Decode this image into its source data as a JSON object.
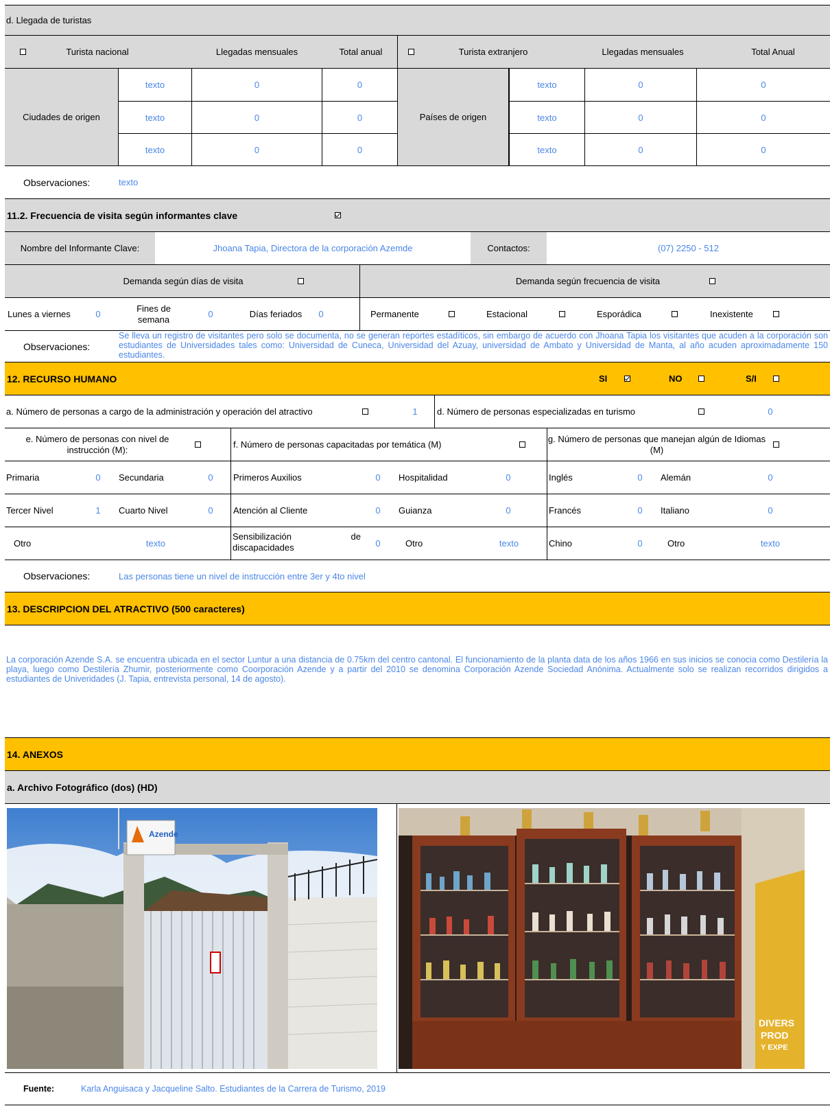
{
  "arrivals": {
    "title": "d. Llegada de turistas",
    "national_label": "Turista nacional",
    "monthly_label": "Llegadas mensuales",
    "annual_label": "Total anual",
    "foreign_label": "Turista extranjero",
    "foreign_monthly_label": "Llegadas mensuales",
    "foreign_annual_label": "Total Anual",
    "cities_label": "Ciudades de origen",
    "countries_label": "Países de origen",
    "rows": [
      {
        "city": "texto",
        "city_monthly": "0",
        "city_annual": "0",
        "country": "texto",
        "country_monthly": "0",
        "country_annual": "0"
      },
      {
        "city": "texto",
        "city_monthly": "0",
        "city_annual": "0",
        "country": "texto",
        "country_monthly": "0",
        "country_annual": "0"
      },
      {
        "city": "texto",
        "city_monthly": "0",
        "city_annual": "0",
        "country": "texto",
        "country_monthly": "0",
        "country_annual": "0"
      }
    ],
    "obs_label": "Observaciones:",
    "obs_value": "texto"
  },
  "frequency": {
    "title": "11.2. Frecuencia de visita según informantes clave",
    "informant_label": "Nombre del Informante Clave:",
    "informant_value": "Jhoana Tapia, Directora de la corporación Azemde",
    "contacts_label": "Contactos:",
    "contacts_value": "(07) 2250 - 512",
    "days_header": "Demanda según  días de visita",
    "freq_header": "Demanda según frecuencia de visita",
    "weekdays_label": "Lunes a viernes",
    "weekdays_value": "0",
    "weekends_label": "Fines de semana",
    "weekends_value": "0",
    "holidays_label": "Días feriados",
    "holidays_value": "0",
    "permanent_label": "Permanente",
    "seasonal_label": "Estacional",
    "sporadic_label": "Esporádica",
    "nonexistent_label": "Inexistente",
    "obs_label": "Observaciones:",
    "obs_value": "Se lleva un registro de visitantes pero solo se documenta, no se generan reportes estadíticos,  sin embargo de acuerdo con Jhoana Tapia los visitantes que acuden a la corporación son estudiantes de Universidades tales como: Universidad de Cuneca, Universidad del Azuay, universidad de Ambato y Universidad de Manta, al año acuden aproximadamente 150 estudiantes."
  },
  "hr": {
    "title": "12. RECURSO HUMANO",
    "yes_label": "SI",
    "no_label": "NO",
    "na_label": "S/I",
    "admin_label": "a. Número de personas a cargo de la administración y operación del atractivo",
    "admin_value": "1",
    "specialized_label": "d. Número de personas especializadas en turismo",
    "specialized_value": "0",
    "education_header": "e. Número de personas con nivel de instrucción (M):",
    "training_header": "f. Número de personas capacitadas por temática (M)",
    "languages_header": "g. Número de personas que manejan algún de Idiomas (M)",
    "rows": [
      {
        "e1": "Primaria",
        "e1v": "0",
        "e2": "Secundaria",
        "e2v": "0",
        "f1": "Primeros Auxilios",
        "f1v": "0",
        "f2": "Hospitalidad",
        "f2v": "0",
        "g1": "Inglés",
        "g1v": "0",
        "g2": "Alemán",
        "g2v": "0"
      },
      {
        "e1": "Tercer Nivel",
        "e1v": "1",
        "e2": "Cuarto Nivel",
        "e2v": "0",
        "f1": "Atención al Cliente",
        "f1v": "0",
        "f2": "Guianza",
        "f2v": "0",
        "g1": "Francés",
        "g1v": "0",
        "g2": "Italiano",
        "g2v": "0"
      }
    ],
    "other_label": "Otro",
    "other_value": "texto",
    "sens_label_a": "Sensibilización",
    "sens_label_b": "de",
    "sens_label_c": "discapacidades",
    "sens_value": "0",
    "other2_label": "Otro",
    "other2_value": "texto",
    "chinese_label": "Chino",
    "chinese_value": "0",
    "other3_label": "Otro",
    "other3_value": "texto",
    "obs_label": "Observaciones:",
    "obs_value": "Las personas tiene un nivel de instrucción entre 3er y 4to nivel"
  },
  "description": {
    "title": "13. DESCRIPCION DEL ATRACTIVO (500 caracteres)",
    "text": "La corporación Azende S.A. se encuentra ubicada en el sector Luntur a una distancia de 0.75km del centro cantonal. El funcionamiento de la planta data de los años 1966 en sus inicios se conocia como Destilería la playa, luego como Destilería  Zhumir, posteriormente  como Coorporación Azende y a partir del 2010 se denomina Corporación Azende Sociedad Anónima. Actualmente solo se realizan recorridos dirigidos a estudiantes de Univeridades (J. Tapia, entrevista personal, 14 de agosto)."
  },
  "annexes": {
    "title": "14. ANEXOS",
    "photo_title": "a. Archivo Fotográfico (dos) (HD)",
    "photo1_sign": "Azende",
    "photo2_sign_a": "DIVERS",
    "photo2_sign_b": "PROD",
    "photo2_sign_c": "Y EXPE",
    "source_label": "Fuente:",
    "source_value": "Karla Anguisaca y Jacqueline Salto. Estudiantes de la Carrera de Turismo, 2019"
  },
  "colors": {
    "section_orange": "#ffc000",
    "header_gray": "#d9d9d9",
    "value_blue": "#4a86e8"
  }
}
